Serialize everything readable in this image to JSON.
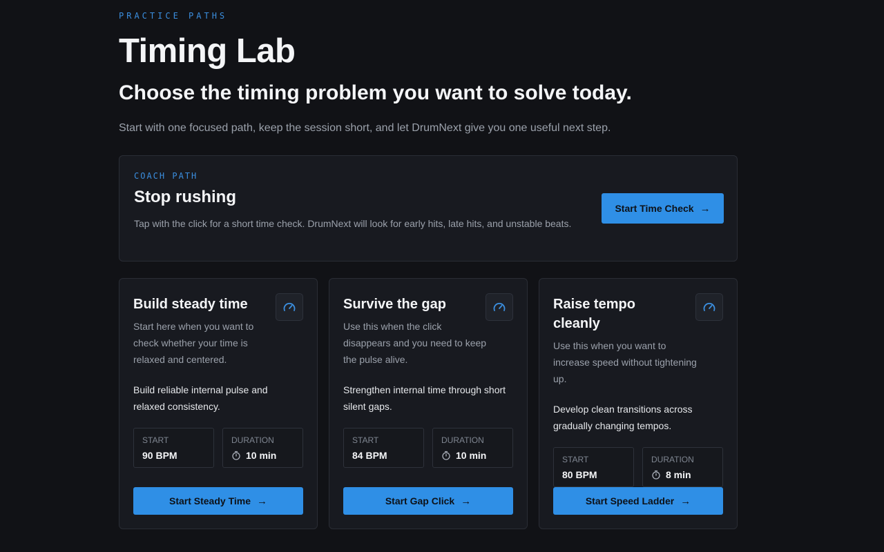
{
  "header": {
    "eyebrow": "PRACTICE PATHS",
    "title": "Timing Lab",
    "subtitle": "Choose the timing problem you want to solve today.",
    "intro": "Start with one focused path, keep the session short, and let DrumNext give you one useful next step."
  },
  "coach": {
    "label": "COACH PATH",
    "heading": "Stop rushing",
    "description": "Tap with the click for a short time check. DrumNext will look for early hits, late hits, and unstable beats.",
    "button_label": "Start Time Check"
  },
  "stat_labels": {
    "start": "START",
    "duration": "DURATION"
  },
  "cards": [
    {
      "title": "Build steady time",
      "description": "Start here when you want to check whether your time is relaxed and centered.",
      "goal": "Build reliable internal pulse and relaxed consistency.",
      "start": "90 BPM",
      "duration": "10 min",
      "button_label": "Start Steady Time"
    },
    {
      "title": "Survive the gap",
      "description": "Use this when the click disappears and you need to keep the pulse alive.",
      "goal": "Strengthen internal time through short silent gaps.",
      "start": "84 BPM",
      "duration": "10 min",
      "button_label": "Start Gap Click"
    },
    {
      "title": "Raise tempo cleanly",
      "description": "Use this when you want to increase speed without tightening up.",
      "goal": "Develop clean transitions across gradually changing tempos.",
      "start": "80 BPM",
      "duration": "8 min",
      "button_label": "Start Speed Ladder"
    }
  ],
  "icons": {
    "card_icon": "gauge-icon",
    "duration_icon": "stopwatch-icon",
    "button_icon": "arrow-right-icon"
  },
  "colors": {
    "background": "#111216",
    "accent": "#2f8fe6",
    "eyebrow": "#3b8fe0"
  }
}
